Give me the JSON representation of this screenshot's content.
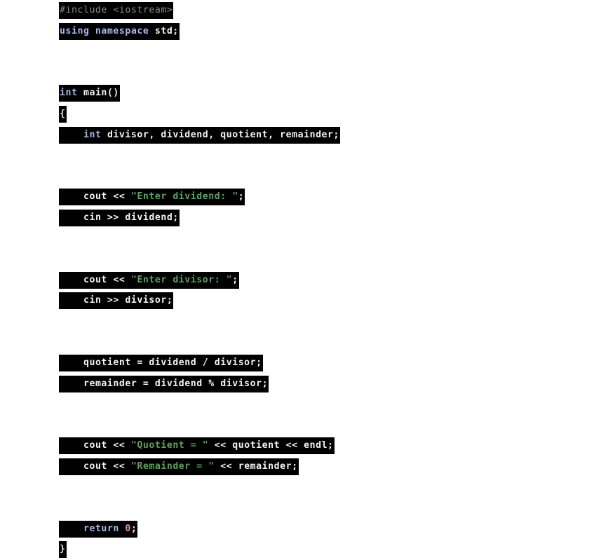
{
  "document": {
    "language": "C++",
    "page_background": "#ffffff",
    "highlight_background": "#000000",
    "colors": {
      "plain": "#f2f2f2",
      "keyword": "#a9b7e8",
      "preprocessor": "#8a8a8a",
      "string": "#5ea05e",
      "number": "#d98fb5"
    }
  },
  "code": {
    "lines": [
      {
        "id": "line-include",
        "blank": false,
        "indent": 0,
        "tokens": [
          {
            "text": "#include <iostream>",
            "type": "preproc"
          }
        ]
      },
      {
        "id": "line-using-namespace",
        "blank": false,
        "indent": 0,
        "tokens": [
          {
            "text": "using namespace ",
            "type": "keyword"
          },
          {
            "text": "std;",
            "type": "plain"
          }
        ]
      },
      {
        "id": "line-blank-1",
        "blank": true,
        "indent": 0,
        "tokens": []
      },
      {
        "id": "line-blank-2",
        "blank": true,
        "indent": 0,
        "tokens": []
      },
      {
        "id": "line-main-signature",
        "blank": false,
        "indent": 0,
        "tokens": [
          {
            "text": "int ",
            "type": "keyword"
          },
          {
            "text": "main()",
            "type": "plain"
          }
        ]
      },
      {
        "id": "line-open-brace",
        "blank": false,
        "indent": 0,
        "tokens": [
          {
            "text": "{",
            "type": "brace"
          }
        ]
      },
      {
        "id": "line-declarations",
        "blank": false,
        "indent": 1,
        "tokens": [
          {
            "text": "int ",
            "type": "keyword"
          },
          {
            "text": "divisor, dividend, quotient, remainder;",
            "type": "plain"
          }
        ]
      },
      {
        "id": "line-blank-3",
        "blank": true,
        "indent": 0,
        "tokens": []
      },
      {
        "id": "line-blank-4",
        "blank": true,
        "indent": 0,
        "tokens": []
      },
      {
        "id": "line-cout-enter-dividend",
        "blank": false,
        "indent": 1,
        "tokens": [
          {
            "text": "cout << ",
            "type": "plain"
          },
          {
            "text": "\"Enter dividend: \"",
            "type": "string"
          },
          {
            "text": ";",
            "type": "plain"
          }
        ]
      },
      {
        "id": "line-cin-dividend",
        "blank": false,
        "indent": 1,
        "tokens": [
          {
            "text": "cin >> dividend;",
            "type": "plain"
          }
        ]
      },
      {
        "id": "line-blank-5",
        "blank": true,
        "indent": 0,
        "tokens": []
      },
      {
        "id": "line-blank-6",
        "blank": true,
        "indent": 0,
        "tokens": []
      },
      {
        "id": "line-cout-enter-divisor",
        "blank": false,
        "indent": 1,
        "tokens": [
          {
            "text": "cout << ",
            "type": "plain"
          },
          {
            "text": "\"Enter divisor: \"",
            "type": "string"
          },
          {
            "text": ";",
            "type": "plain"
          }
        ]
      },
      {
        "id": "line-cin-divisor",
        "blank": false,
        "indent": 1,
        "tokens": [
          {
            "text": "cin >> divisor;",
            "type": "plain"
          }
        ]
      },
      {
        "id": "line-blank-7",
        "blank": true,
        "indent": 0,
        "tokens": []
      },
      {
        "id": "line-blank-8",
        "blank": true,
        "indent": 0,
        "tokens": []
      },
      {
        "id": "line-compute-quotient",
        "blank": false,
        "indent": 1,
        "tokens": [
          {
            "text": "quotient = dividend / divisor;",
            "type": "plain"
          }
        ]
      },
      {
        "id": "line-compute-remainder",
        "blank": false,
        "indent": 1,
        "tokens": [
          {
            "text": "remainder = dividend % divisor;",
            "type": "plain"
          }
        ]
      },
      {
        "id": "line-blank-9",
        "blank": true,
        "indent": 0,
        "tokens": []
      },
      {
        "id": "line-blank-10",
        "blank": true,
        "indent": 0,
        "tokens": []
      },
      {
        "id": "line-cout-quotient",
        "blank": false,
        "indent": 1,
        "tokens": [
          {
            "text": "cout << ",
            "type": "plain"
          },
          {
            "text": "\"Quotient = \"",
            "type": "string"
          },
          {
            "text": " << quotient << endl;",
            "type": "plain"
          }
        ]
      },
      {
        "id": "line-cout-remainder",
        "blank": false,
        "indent": 1,
        "tokens": [
          {
            "text": "cout << ",
            "type": "plain"
          },
          {
            "text": "\"Remainder = \"",
            "type": "string"
          },
          {
            "text": " << remainder;",
            "type": "plain"
          }
        ]
      },
      {
        "id": "line-blank-11",
        "blank": true,
        "indent": 0,
        "tokens": []
      },
      {
        "id": "line-blank-12",
        "blank": true,
        "indent": 0,
        "tokens": []
      },
      {
        "id": "line-return",
        "blank": false,
        "indent": 1,
        "tokens": [
          {
            "text": "return ",
            "type": "keyword"
          },
          {
            "text": "0",
            "type": "number"
          },
          {
            "text": ";",
            "type": "plain"
          }
        ]
      },
      {
        "id": "line-close-brace",
        "blank": false,
        "indent": 0,
        "tokens": [
          {
            "text": "}",
            "type": "brace"
          }
        ]
      }
    ]
  }
}
